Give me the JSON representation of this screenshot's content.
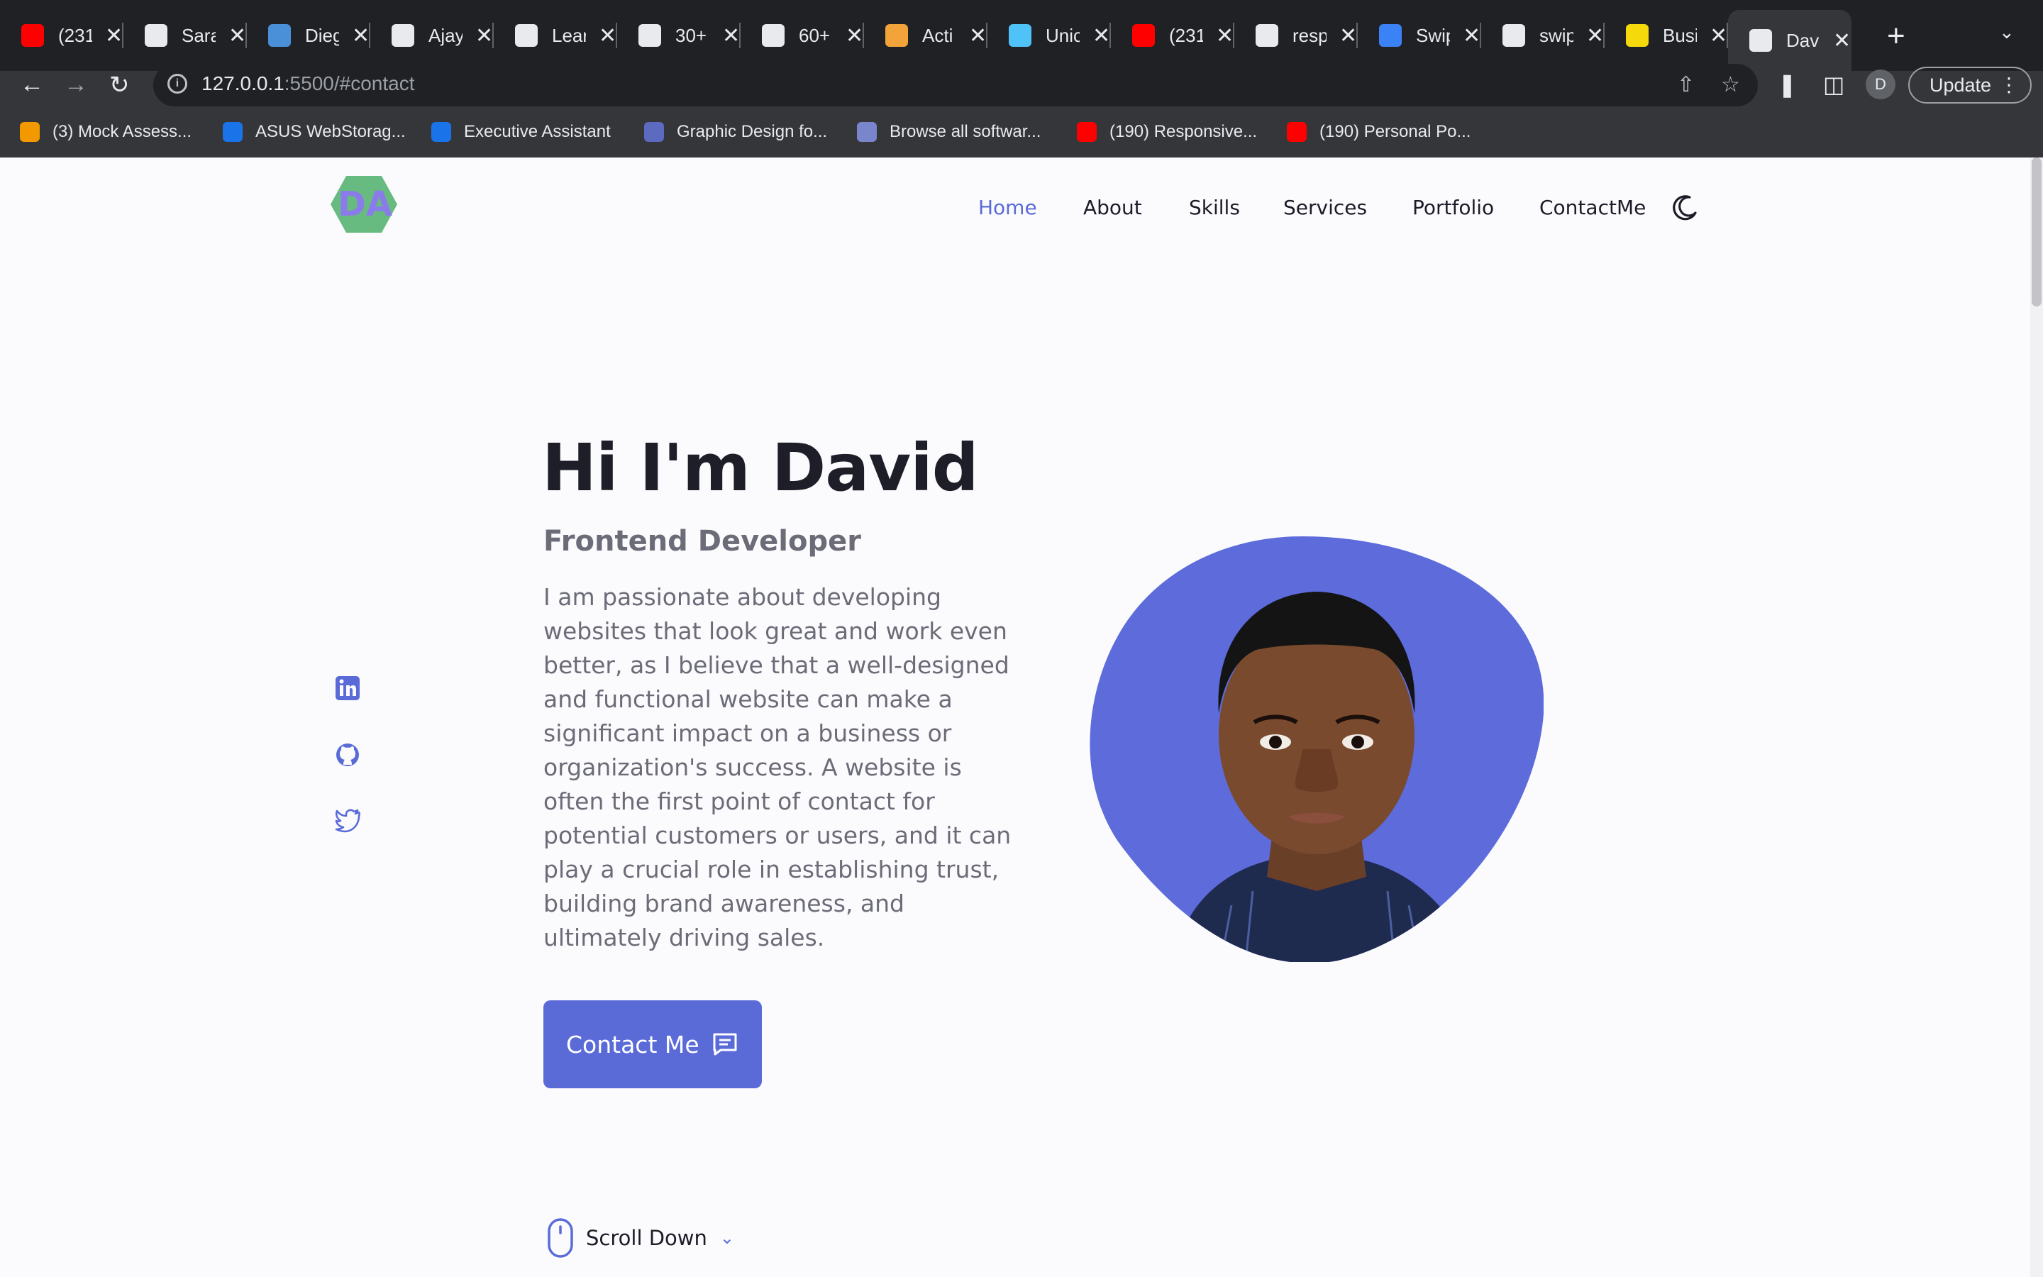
{
  "browser": {
    "tabs": [
      {
        "title": "(231",
        "icon": "youtube-icon",
        "color": "#ff0000"
      },
      {
        "title": "Sara",
        "icon": "globe-icon",
        "color": "#e8eaed"
      },
      {
        "title": "Dieg",
        "icon": "site-logo-icon",
        "color": "#4a90d9"
      },
      {
        "title": "Ajay",
        "icon": "avatar-icon",
        "color": "#e8eaed"
      },
      {
        "title": "Lear",
        "icon": "document-icon",
        "color": "#e8eaed"
      },
      {
        "title": "30+",
        "icon": "document-icon",
        "color": "#e8eaed"
      },
      {
        "title": "60+",
        "icon": "document-icon",
        "color": "#e8eaed"
      },
      {
        "title": "Acti",
        "icon": "pencil-icon",
        "color": "#f2a33a"
      },
      {
        "title": "Unic",
        "icon": "search-icon",
        "color": "#4fc3f7"
      },
      {
        "title": "(231",
        "icon": "youtube-icon",
        "color": "#ff0000"
      },
      {
        "title": "resp",
        "icon": "github-icon",
        "color": "#e8eaed"
      },
      {
        "title": "Swip",
        "icon": "swiper-icon",
        "color": "#3b82f6"
      },
      {
        "title": "swip",
        "icon": "github-icon",
        "color": "#e8eaed"
      },
      {
        "title": "Busi",
        "icon": "business-icon",
        "color": "#f5d90a"
      },
      {
        "title": "Davi",
        "icon": "globe-icon",
        "color": "#e8eaed",
        "active": true
      }
    ],
    "url_host": "127.0.0.1",
    "url_path": ":5500/#contact",
    "profile_initial": "D",
    "update_label": "Update",
    "bookmarks": [
      {
        "label": "(3) Mock Assess...",
        "icon": "bookmark-site-icon",
        "color": "#f29900"
      },
      {
        "label": "ASUS WebStorag...",
        "icon": "asus-icon",
        "color": "#1a73e8"
      },
      {
        "label": "Executive Assistant",
        "icon": "shield-icon",
        "color": "#1a73e8"
      },
      {
        "label": "Graphic Design fo...",
        "icon": "design-icon",
        "color": "#5c6bc0"
      },
      {
        "label": "Browse all softwar...",
        "icon": "software-icon",
        "color": "#7986cb"
      },
      {
        "label": "(190) Responsive...",
        "icon": "youtube-icon",
        "color": "#ff0000"
      },
      {
        "label": "(190) Personal Po...",
        "icon": "youtube-icon",
        "color": "#ff0000"
      }
    ]
  },
  "site": {
    "logo_text": "DA",
    "nav": [
      {
        "label": "Home",
        "active": true
      },
      {
        "label": "About"
      },
      {
        "label": "Skills"
      },
      {
        "label": "Services"
      },
      {
        "label": "Portfolio"
      },
      {
        "label": "ContactMe"
      }
    ],
    "accent_color": "#5a6bd8",
    "hero": {
      "title": "Hi I'm David",
      "subtitle": "Frontend Developer",
      "description": "I am passionate about developing websites that look great and work even better, as I believe that a well-designed and functional website can make a significant impact on a business or organization's success. A website is often the first point of contact for potential customers or users, and it can play a crucial role in establishing trust, building brand awareness, and ultimately driving sales.",
      "button_label": "Contact Me"
    },
    "social": [
      "linkedin-icon",
      "github-icon",
      "twitter-icon"
    ],
    "scroll_label": "Scroll Down"
  }
}
